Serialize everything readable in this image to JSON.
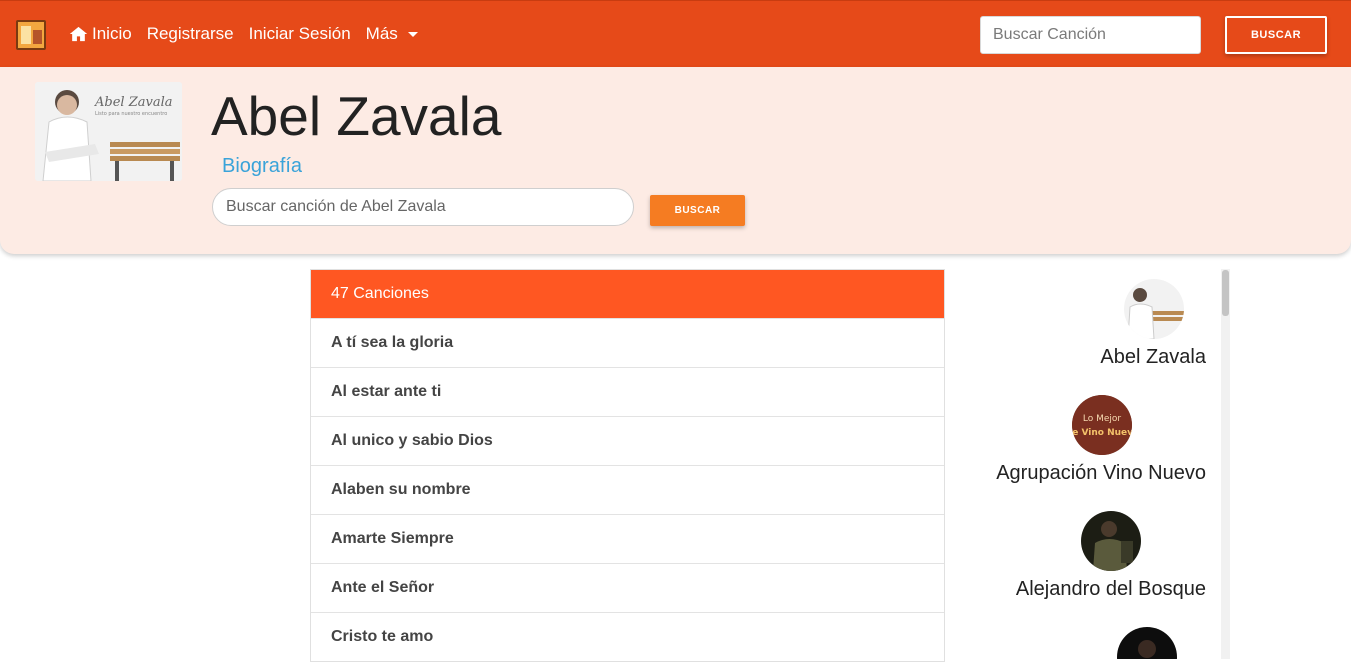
{
  "nav": {
    "logo": "music-book-logo",
    "links": {
      "home": "Inicio",
      "register": "Registrarse",
      "login": "Iniciar Sesión",
      "more": "Más"
    },
    "search_placeholder": "Buscar Canción",
    "search_button": "BUSCAR"
  },
  "artist": {
    "name": "Abel Zavala",
    "bio_link": "Biografía",
    "search_placeholder": "Buscar canción de Abel Zavala",
    "search_button": "BUSCAR",
    "photo_lettering": "Abel Zavala",
    "photo_caption": "Listo para nuestro encuentro"
  },
  "songs": {
    "header": "47 Canciones",
    "items": [
      "A tí sea la gloria",
      "Al estar ante ti",
      "Al unico y sabio Dios",
      "Alaben su nombre",
      "Amarte Siempre",
      "Ante el Señor",
      "Cristo te amo"
    ]
  },
  "related_artists": [
    {
      "name": "Abel Zavala",
      "avatar_text": ""
    },
    {
      "name": "Agrupación Vino Nuevo",
      "avatar_text": "Lo Mejor De Vino Nuevo"
    },
    {
      "name": "Alejandro del Bosque",
      "avatar_text": ""
    },
    {
      "name": "",
      "avatar_text": ""
    }
  ],
  "colors": {
    "navbar": "#e64a19",
    "header_bg": "#fdebe4",
    "list_header": "#ff5722",
    "artist_search_button": "#f57c22",
    "link": "#3aa3d9"
  }
}
